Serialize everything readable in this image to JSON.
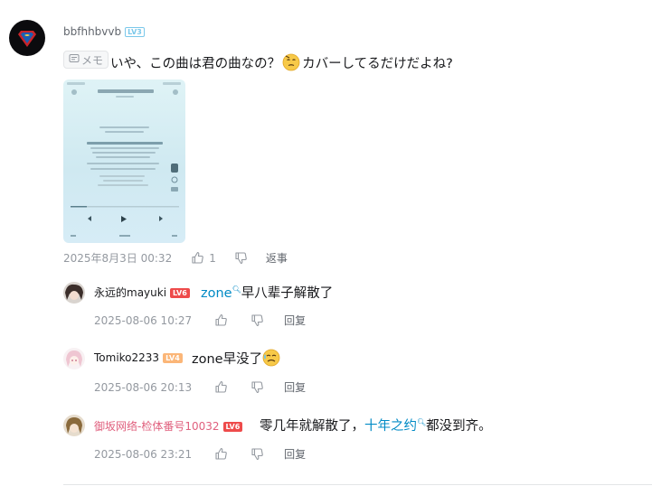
{
  "main_comment": {
    "username": "bbfhhbvvb",
    "level": "LV3",
    "memo_label": "メモ",
    "text_before_emoji": "いや、この曲は君の曲なの？",
    "text_after_emoji": "カバーしてるだけだよね?",
    "emoji_name": "thinking-face-emoji",
    "timestamp": "2025年8月3日 00:32",
    "like_count": "1",
    "reply_label": "返事"
  },
  "replies": [
    {
      "username": "永远的mayuki",
      "level": "LV6",
      "link_text": "zone",
      "text": "早八辈子解散了",
      "timestamp": "2025-08-06 10:27",
      "reply_label": "回复"
    },
    {
      "username": "Tomiko2233",
      "level": "LV4",
      "text": "zone早没了",
      "emoji_name": "crying-face-emoji",
      "timestamp": "2025-08-06 20:13",
      "reply_label": "回复"
    },
    {
      "username": "御坂网络-检体番号10032",
      "level": "LV6",
      "text_before_link": "零几年就解散了，",
      "link_text": "十年之约",
      "text_after_link": "都没到齐。",
      "timestamp": "2025-08-06 23:21",
      "reply_label": "回复"
    }
  ],
  "colors": {
    "username_vip": "#e0607e",
    "link": "#008ac5",
    "meta": "#9499a0"
  }
}
